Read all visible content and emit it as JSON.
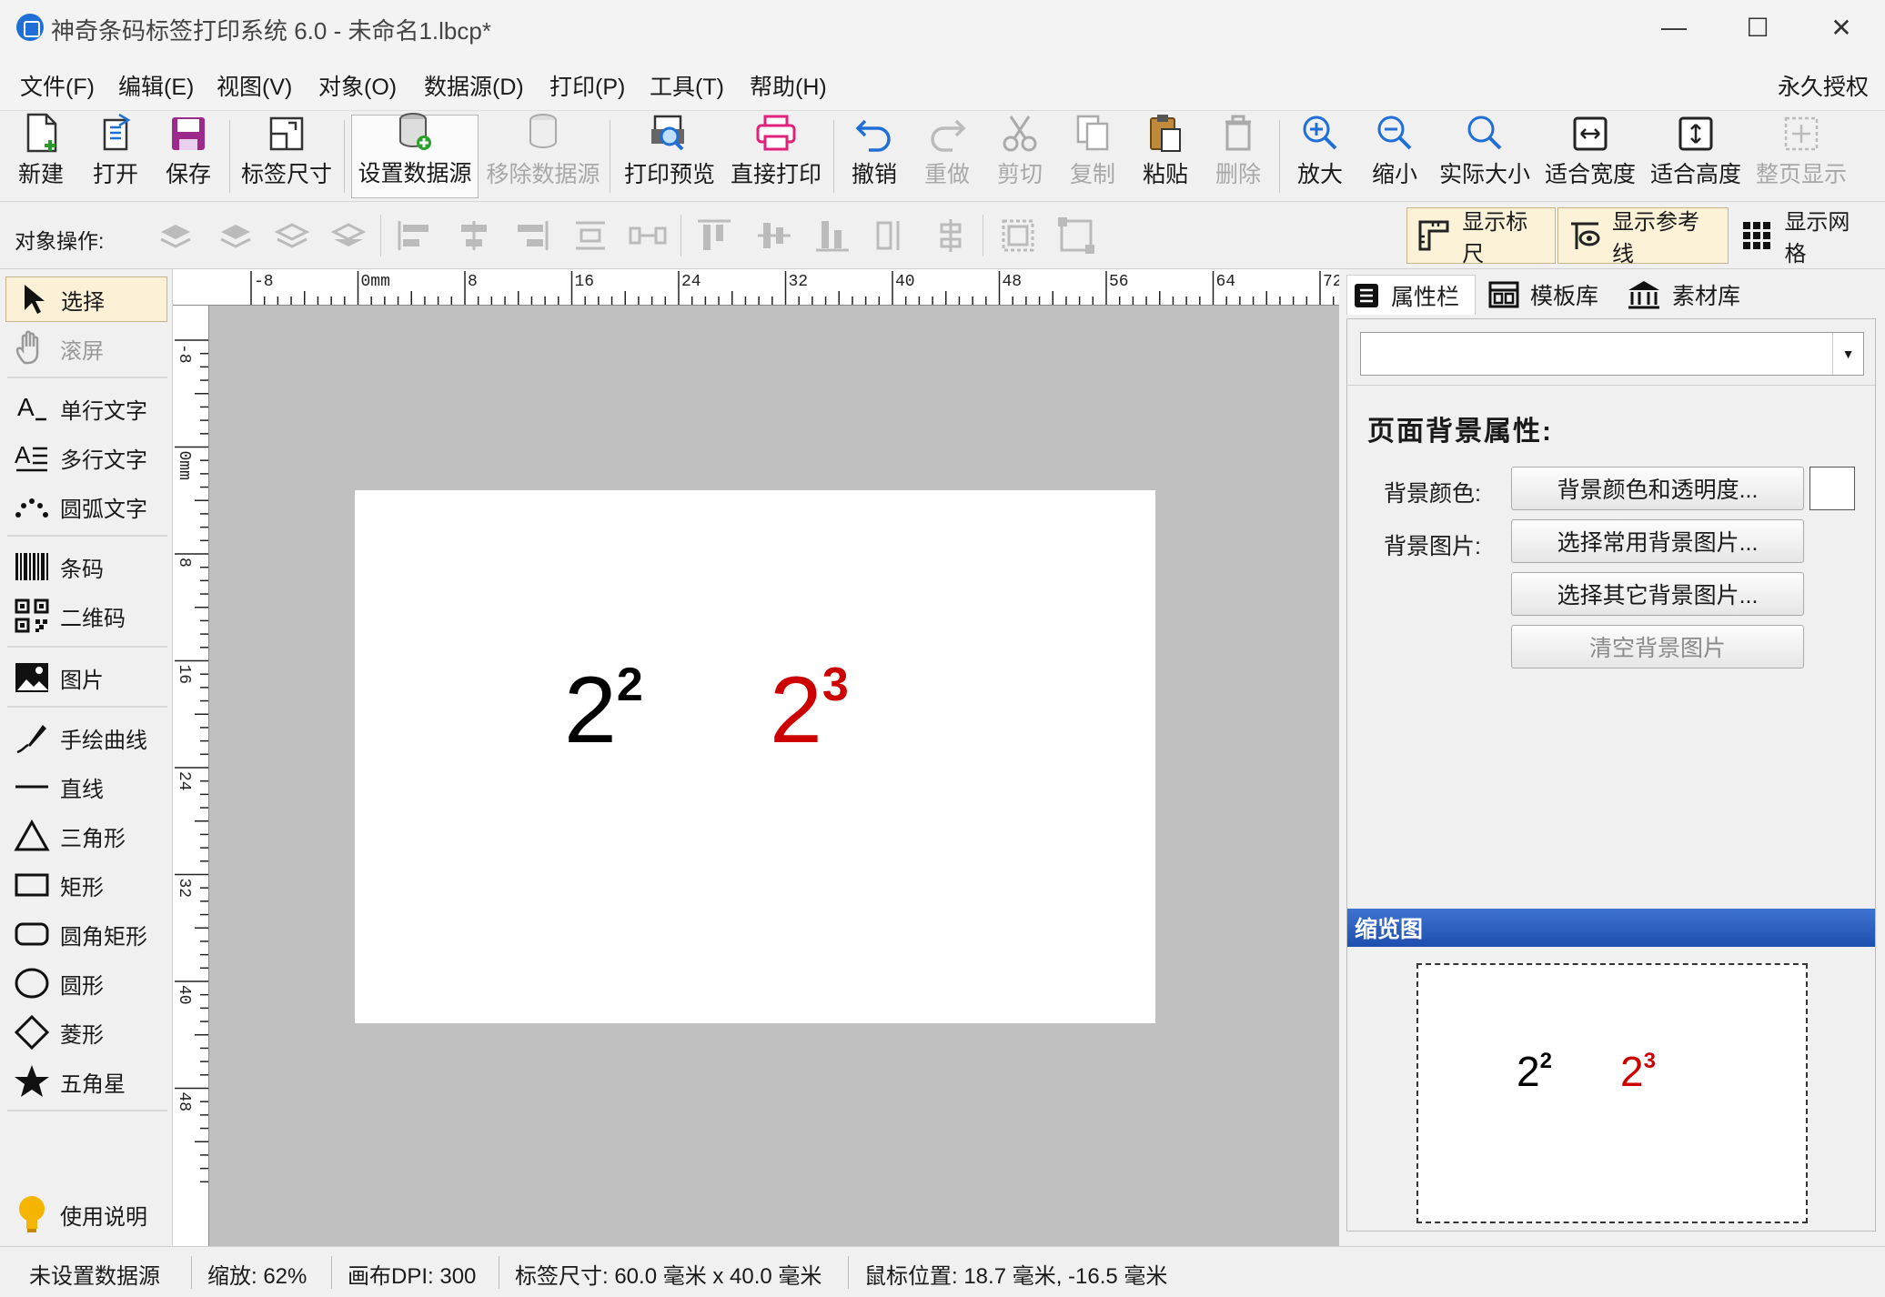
{
  "window": {
    "title": "神奇条码标签打印系统 6.0 - 未命名1.lbcp*",
    "minimize_glyph": "—",
    "maximize_glyph": "☐",
    "close_glyph": "✕"
  },
  "menu": {
    "items": [
      "文件(F)",
      "编辑(E)",
      "视图(V)",
      "对象(O)",
      "数据源(D)",
      "打印(P)",
      "工具(T)",
      "帮助(H)"
    ],
    "license": "永久授权"
  },
  "toolbar": {
    "new": "新建",
    "open": "打开",
    "save": "保存",
    "label_size": "标签尺寸",
    "set_datasource": "设置数据源",
    "remove_datasource": "移除数据源",
    "print_preview": "打印预览",
    "direct_print": "直接打印",
    "undo": "撤销",
    "redo": "重做",
    "cut": "剪切",
    "copy": "复制",
    "paste": "粘贴",
    "delete": "删除",
    "zoom_in": "放大",
    "zoom_out": "缩小",
    "actual_size": "实际大小",
    "fit_width": "适合宽度",
    "fit_height": "适合高度",
    "full_page": "整页显示"
  },
  "object_ops": {
    "label": "对象操作:",
    "show_ruler": "显示标尺",
    "show_guides": "显示参考线",
    "show_grid": "显示网格"
  },
  "tools": {
    "select": "选择",
    "scroll": "滚屏",
    "single_text": "单行文字",
    "multi_text": "多行文字",
    "arc_text": "圆弧文字",
    "barcode": "条码",
    "qrcode": "二维码",
    "image": "图片",
    "freehand": "手绘曲线",
    "line": "直线",
    "triangle": "三角形",
    "rectangle": "矩形",
    "rounded_rect": "圆角矩形",
    "circle": "圆形",
    "diamond": "菱形",
    "star": "五角星",
    "help": "使用说明"
  },
  "ruler": {
    "h_labels": [
      "-8",
      "0mm",
      "8",
      "16",
      "24",
      "32",
      "40",
      "48",
      "56",
      "64",
      "72"
    ],
    "v_labels": [
      "-8",
      "0mm",
      "8",
      "16",
      "24",
      "32",
      "40",
      "48"
    ]
  },
  "label_content": {
    "text1_base": "2",
    "text1_exp": "2",
    "text1_color": "#000000",
    "text2_base": "2",
    "text2_exp": "3",
    "text2_color": "#cc0000"
  },
  "right_panel": {
    "tabs": [
      "属性栏",
      "模板库",
      "素材库"
    ],
    "section_title": "页面背景属性:",
    "bg_color_label": "背景颜色:",
    "bg_color_button": "背景颜色和透明度...",
    "bg_image_label": "背景图片:",
    "bg_image_common": "选择常用背景图片...",
    "bg_image_other": "选择其它背景图片...",
    "bg_image_clear": "清空背景图片",
    "thumbnail_title": "缩览图"
  },
  "status": {
    "datasource": "未设置数据源",
    "zoom": "缩放: 62%",
    "dpi": "画布DPI: 300",
    "label_size": "标签尺寸: 60.0 毫米 x 40.0 毫米",
    "mouse_pos": "鼠标位置: 18.7 毫米, -16.5 毫米"
  },
  "colors": {
    "accent_blue": "#1f6fd6",
    "thumbnail_header": "#2a5cbf",
    "canvas_bg": "#c0c0c0",
    "selected_tool_bg": "#fcf0d6"
  }
}
